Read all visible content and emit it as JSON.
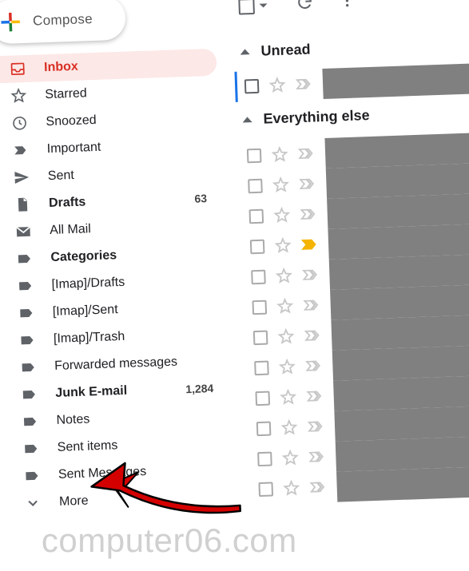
{
  "compose": {
    "label": "Compose"
  },
  "sidebar": {
    "items": [
      {
        "icon": "inbox",
        "label": "Inbox",
        "count": "",
        "active": true,
        "bold": true
      },
      {
        "icon": "star",
        "label": "Starred",
        "count": ""
      },
      {
        "icon": "clock",
        "label": "Snoozed",
        "count": ""
      },
      {
        "icon": "importance",
        "label": "Important",
        "count": ""
      },
      {
        "icon": "send",
        "label": "Sent",
        "count": ""
      },
      {
        "icon": "file",
        "label": "Drafts",
        "count": "63",
        "bold": true
      },
      {
        "icon": "mail",
        "label": "All Mail",
        "count": ""
      },
      {
        "icon": "label",
        "label": "Categories",
        "count": "",
        "bold": true
      },
      {
        "icon": "label",
        "label": "[Imap]/Drafts",
        "count": ""
      },
      {
        "icon": "label",
        "label": "[Imap]/Sent",
        "count": ""
      },
      {
        "icon": "label",
        "label": "[Imap]/Trash",
        "count": ""
      },
      {
        "icon": "label",
        "label": "Forwarded messages",
        "count": ""
      },
      {
        "icon": "label",
        "label": "Junk E-mail",
        "count": "1,284",
        "bold": true
      },
      {
        "icon": "label",
        "label": "Notes",
        "count": ""
      },
      {
        "icon": "label",
        "label": "Sent items",
        "count": ""
      },
      {
        "icon": "label",
        "label": "Sent Messages",
        "count": ""
      },
      {
        "icon": "chevron-down",
        "label": "More",
        "count": ""
      }
    ]
  },
  "sections": {
    "unread": "Unread",
    "else": "Everything else"
  },
  "mailRows": {
    "unread": [
      {
        "accent": true,
        "starFilled": false,
        "importanceFilled": false
      }
    ],
    "else": [
      {
        "starFilled": false,
        "importanceFilled": false
      },
      {
        "starFilled": false,
        "importanceFilled": false
      },
      {
        "starFilled": false,
        "importanceFilled": false
      },
      {
        "starFilled": false,
        "importanceFilled": true
      },
      {
        "starFilled": false,
        "importanceFilled": false
      },
      {
        "starFilled": false,
        "importanceFilled": false
      },
      {
        "starFilled": false,
        "importanceFilled": false
      },
      {
        "starFilled": false,
        "importanceFilled": false
      },
      {
        "starFilled": false,
        "importanceFilled": false
      },
      {
        "starFilled": false,
        "importanceFilled": false
      },
      {
        "starFilled": false,
        "importanceFilled": false
      },
      {
        "starFilled": false,
        "importanceFilled": false
      }
    ]
  },
  "watermark": "computer06.com"
}
